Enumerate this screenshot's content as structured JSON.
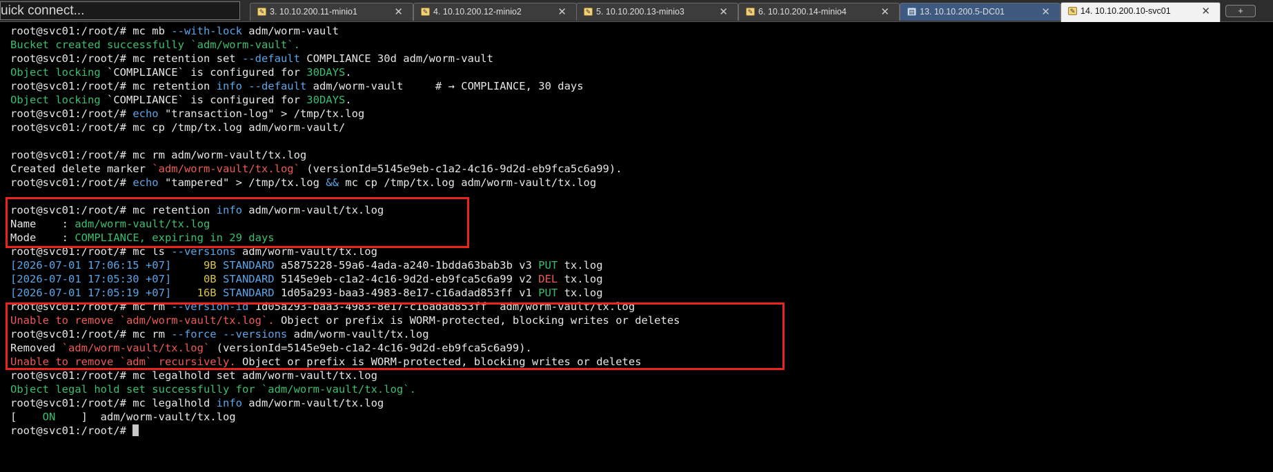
{
  "quick_connect": {
    "label": "uick connect..."
  },
  "tabs": [
    {
      "label": "3. 10.10.200.11-minio1",
      "type": "ssh",
      "active": false
    },
    {
      "label": "4. 10.10.200.12-minio2",
      "type": "ssh",
      "active": false
    },
    {
      "label": "5. 10.10.200.13-minio3",
      "type": "ssh",
      "active": false
    },
    {
      "label": "6. 10.10.200.14-minio4",
      "type": "ssh",
      "active": false
    },
    {
      "label": "13. 10.10.200.5-DC01",
      "type": "rdp",
      "active": false
    },
    {
      "label": "14. 10.10.200.10-svc01",
      "type": "ssh",
      "active": true
    }
  ],
  "tab_close_glyph": "✕",
  "new_tab_label": "+",
  "icons": {
    "ssh_tab": "terminal-key-icon",
    "rdp_tab": "remote-desktop-icon",
    "close": "close-icon"
  },
  "colors": {
    "prompt": "#e6e6e6",
    "success": "#3bbf6e",
    "keyword": "#5aa5e8",
    "error": "#ee5a55",
    "size": "#d8c44a",
    "highlight_box": "#e8241c"
  },
  "terminal": {
    "lines": [
      {
        "segments": [
          {
            "t": "root@svc01:/root/# mc mb ",
            "c": ""
          },
          {
            "t": "--with-lock",
            "c": "b"
          },
          {
            "t": " adm/worm-vault",
            "c": ""
          }
        ]
      },
      {
        "segments": [
          {
            "t": "Bucket created successfully `adm/worm-vault`.",
            "c": "g"
          }
        ]
      },
      {
        "segments": [
          {
            "t": "root@svc01:/root/# mc retention set ",
            "c": ""
          },
          {
            "t": "--default",
            "c": "b"
          },
          {
            "t": " COMPLIANCE 30d adm/worm-vault",
            "c": ""
          }
        ]
      },
      {
        "segments": [
          {
            "t": "Object locking ",
            "c": "g"
          },
          {
            "t": "`COMPLIANCE`",
            "c": ""
          },
          {
            "t": " is configured for ",
            "c": ""
          },
          {
            "t": "30DAYS",
            "c": "g"
          },
          {
            "t": ".",
            "c": ""
          }
        ]
      },
      {
        "segments": [
          {
            "t": "root@svc01:/root/# mc retention ",
            "c": ""
          },
          {
            "t": "info",
            "c": "b"
          },
          {
            "t": " ",
            "c": ""
          },
          {
            "t": "--default",
            "c": "b"
          },
          {
            "t": " adm/worm-vault     # → COMPLIANCE, 30 days",
            "c": ""
          }
        ]
      },
      {
        "segments": [
          {
            "t": "Object locking ",
            "c": "g"
          },
          {
            "t": "`COMPLIANCE`",
            "c": ""
          },
          {
            "t": " is configured for ",
            "c": ""
          },
          {
            "t": "30DAYS",
            "c": "g"
          },
          {
            "t": ".",
            "c": ""
          }
        ]
      },
      {
        "segments": [
          {
            "t": "root@svc01:/root/# ",
            "c": ""
          },
          {
            "t": "echo",
            "c": "b"
          },
          {
            "t": " \"transaction-log\" > /tmp/tx.log",
            "c": ""
          }
        ]
      },
      {
        "segments": [
          {
            "t": "root@svc01:/root/# mc cp /tmp/tx.log adm/worm-vault/",
            "c": ""
          }
        ]
      },
      {
        "segments": [
          {
            "t": "",
            "c": ""
          }
        ]
      },
      {
        "segments": [
          {
            "t": "root@svc01:/root/# mc rm adm/worm-vault/tx.log",
            "c": ""
          }
        ]
      },
      {
        "segments": [
          {
            "t": "Created delete marker ",
            "c": ""
          },
          {
            "t": "`adm/worm-vault/tx.log`",
            "c": "r"
          },
          {
            "t": " (versionId=5145e9eb-c1a2-4c16-9d2d-eb9fca5c6a99).",
            "c": ""
          }
        ]
      },
      {
        "segments": [
          {
            "t": "root@svc01:/root/# ",
            "c": ""
          },
          {
            "t": "echo",
            "c": "b"
          },
          {
            "t": " \"tampered\" > /tmp/tx.log ",
            "c": ""
          },
          {
            "t": "&&",
            "c": "b"
          },
          {
            "t": " mc cp /tmp/tx.log adm/worm-vault/tx.log",
            "c": ""
          }
        ]
      },
      {
        "segments": [
          {
            "t": "",
            "c": ""
          }
        ]
      },
      {
        "segments": [
          {
            "t": "root@svc01:/root/# mc retention ",
            "c": ""
          },
          {
            "t": "info",
            "c": "b"
          },
          {
            "t": " adm/worm-vault/tx.log",
            "c": ""
          }
        ]
      },
      {
        "segments": [
          {
            "t": "Name    : ",
            "c": ""
          },
          {
            "t": "adm/worm-vault/tx.log",
            "c": "g"
          }
        ]
      },
      {
        "segments": [
          {
            "t": "Mode    : ",
            "c": ""
          },
          {
            "t": "COMPLIANCE, expiring in 29 days",
            "c": "g"
          }
        ]
      },
      {
        "segments": [
          {
            "t": "root@svc01:/root/# mc ls ",
            "c": ""
          },
          {
            "t": "--versions",
            "c": "b"
          },
          {
            "t": " adm/worm-vault/tx.log",
            "c": ""
          }
        ]
      },
      {
        "segments": [
          {
            "t": "[2026-07-01 17:06:15 +07]",
            "c": "b"
          },
          {
            "t": "     ",
            "c": ""
          },
          {
            "t": "9B",
            "c": "y"
          },
          {
            "t": " ",
            "c": ""
          },
          {
            "t": "STANDARD",
            "c": "b"
          },
          {
            "t": " a5875228-59a6-4ada-a240-1bdda63bab3b v3 ",
            "c": ""
          },
          {
            "t": "PUT",
            "c": "g"
          },
          {
            "t": " tx.log",
            "c": ""
          }
        ]
      },
      {
        "segments": [
          {
            "t": "[2026-07-01 17:05:30 +07]",
            "c": "b"
          },
          {
            "t": "     ",
            "c": ""
          },
          {
            "t": "0B",
            "c": "y"
          },
          {
            "t": " ",
            "c": ""
          },
          {
            "t": "STANDARD",
            "c": "b"
          },
          {
            "t": " 5145e9eb-c1a2-4c16-9d2d-eb9fca5c6a99 v2 ",
            "c": ""
          },
          {
            "t": "DEL",
            "c": "r"
          },
          {
            "t": " tx.log",
            "c": ""
          }
        ]
      },
      {
        "segments": [
          {
            "t": "[2026-07-01 17:05:19 +07]",
            "c": "b"
          },
          {
            "t": "    ",
            "c": ""
          },
          {
            "t": "16B",
            "c": "y"
          },
          {
            "t": " ",
            "c": ""
          },
          {
            "t": "STANDARD",
            "c": "b"
          },
          {
            "t": " 1d05a293-baa3-4983-8e17-c16adad853ff v1 ",
            "c": ""
          },
          {
            "t": "PUT",
            "c": "g"
          },
          {
            "t": " tx.log",
            "c": ""
          }
        ]
      },
      {
        "segments": [
          {
            "t": "root@svc01:/root/# mc rm ",
            "c": ""
          },
          {
            "t": "--version-id",
            "c": "b"
          },
          {
            "t": " 1d05a293-baa3-4983-8e17-c16adad853ff  adm/worm-vault/tx.log",
            "c": ""
          }
        ]
      },
      {
        "segments": [
          {
            "t": "Unable to remove `adm/worm-vault/tx.log`.",
            "c": "r"
          },
          {
            "t": " Object or prefix is WORM-protected, blocking writes or deletes",
            "c": ""
          }
        ]
      },
      {
        "segments": [
          {
            "t": "root@svc01:/root/# mc rm ",
            "c": ""
          },
          {
            "t": "--force --versions",
            "c": "b"
          },
          {
            "t": " adm/worm-vault/tx.log",
            "c": ""
          }
        ]
      },
      {
        "segments": [
          {
            "t": "Removed ",
            "c": ""
          },
          {
            "t": "`adm/worm-vault/tx.log`",
            "c": "r"
          },
          {
            "t": " (versionId=5145e9eb-c1a2-4c16-9d2d-eb9fca5c6a99).",
            "c": ""
          }
        ]
      },
      {
        "segments": [
          {
            "t": "Unable to remove `adm` recursively.",
            "c": "r"
          },
          {
            "t": " Object or prefix is WORM-protected, blocking writes or deletes",
            "c": ""
          }
        ]
      },
      {
        "segments": [
          {
            "t": "root@svc01:/root/# mc legalhold set adm/worm-vault/tx.log",
            "c": ""
          }
        ]
      },
      {
        "segments": [
          {
            "t": "Object legal hold set successfully for `adm/worm-vault/tx.log`.",
            "c": "g"
          }
        ]
      },
      {
        "segments": [
          {
            "t": "root@svc01:/root/# mc legalhold ",
            "c": ""
          },
          {
            "t": "info",
            "c": "b"
          },
          {
            "t": " adm/worm-vault/tx.log",
            "c": ""
          }
        ]
      },
      {
        "segments": [
          {
            "t": "[    ",
            "c": ""
          },
          {
            "t": "ON",
            "c": "g"
          },
          {
            "t": "    ]  adm/worm-vault/tx.log",
            "c": ""
          }
        ]
      },
      {
        "segments": [
          {
            "t": "root@svc01:/root/# ",
            "c": ""
          }
        ],
        "cursor": true
      }
    ]
  }
}
